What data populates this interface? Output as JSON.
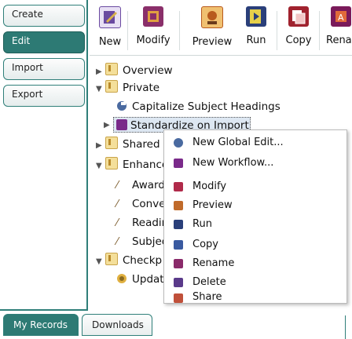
{
  "sidebar": {
    "items": [
      {
        "label": "Create",
        "active": false
      },
      {
        "label": "Edit",
        "active": true
      },
      {
        "label": "Import",
        "active": false
      },
      {
        "label": "Export",
        "active": false
      }
    ]
  },
  "toolbar": {
    "buttons": [
      {
        "label": "New",
        "icon": "new-edit-icon",
        "color": "#6a4aa0"
      },
      {
        "label": "Modify",
        "icon": "modify-icon",
        "color": "#8a2f6a"
      },
      {
        "label": "Preview",
        "icon": "preview-icon",
        "color": "#b85a1e"
      },
      {
        "label": "Run",
        "icon": "run-icon",
        "color": "#2a3f7a"
      },
      {
        "label": "Copy",
        "icon": "copy-icon",
        "color": "#a0222e"
      },
      {
        "label": "Renar",
        "icon": "rename-icon",
        "color": "#7a1a5a"
      }
    ]
  },
  "tree": {
    "overview": "Overview",
    "private": "Private",
    "capitalize": "Capitalize Subject Headings",
    "standardize": "Standardize on Import",
    "shared": "Shared",
    "enhance": "Enhance",
    "award": "Award",
    "conve": "Conve",
    "readir": "Readir",
    "subjec": "Subjec",
    "checkp": "Checkp",
    "updat": "Updat"
  },
  "context_menu": {
    "items": [
      {
        "label": "New Global Edit...",
        "icon": "global-edit-icon",
        "color": "#4a6aa0"
      },
      {
        "label": "New Workflow...",
        "icon": "workflow-icon",
        "color": "#7a2a8a"
      },
      {
        "label": "Modify",
        "icon": "modify-icon",
        "color": "#b02a4a"
      },
      {
        "label": "Preview",
        "icon": "preview-icon",
        "color": "#c06a2a"
      },
      {
        "label": "Run",
        "icon": "run-icon",
        "color": "#2a3f7a"
      },
      {
        "label": "Copy",
        "icon": "copy-icon",
        "color": "#3a5aa0"
      },
      {
        "label": "Rename",
        "icon": "rename-icon",
        "color": "#8a2a6a"
      },
      {
        "label": "Delete",
        "icon": "delete-icon",
        "color": "#5a3a8a"
      },
      {
        "label": "Share",
        "icon": "share-icon",
        "color": "#c0503a"
      }
    ]
  },
  "bottom_tabs": [
    {
      "label": "My Records",
      "active": true
    },
    {
      "label": "Downloads",
      "active": false
    }
  ]
}
